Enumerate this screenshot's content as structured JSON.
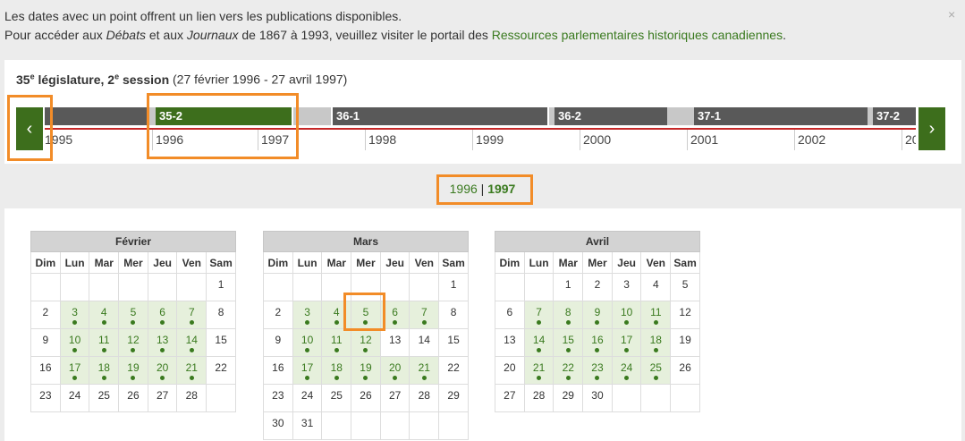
{
  "notice": {
    "line1": "Les dates avec un point offrent un lien vers les publications disponibles.",
    "line2_pre": "Pour accéder aux ",
    "line2_em1": "Débats",
    "line2_mid1": " et aux ",
    "line2_em2": "Journaux",
    "line2_mid2": " de 1867 à 1993, veuillez visiter le portail des ",
    "line2_link": "Ressources parlementaires historiques canadiennes",
    "line2_end": ".",
    "close": "×"
  },
  "session": {
    "num": "35",
    "sup1": "e",
    "legislature": " législature, 2",
    "sup2": "e",
    "session_word": " session",
    "dates": " (27 février 1996 - 27 avril 1997)"
  },
  "nav": {
    "prev": "‹",
    "next": "›"
  },
  "timeline": {
    "segments": [
      {
        "label": "",
        "style": "dark"
      },
      {
        "label": "",
        "style": "light"
      },
      {
        "label": "35-2",
        "style": "active"
      },
      {
        "label": "",
        "style": "light"
      },
      {
        "label": "36-1",
        "style": "dark"
      },
      {
        "label": "",
        "style": "light"
      },
      {
        "label": "36-2",
        "style": "dark"
      },
      {
        "label": "",
        "style": "light"
      },
      {
        "label": "37-1",
        "style": "dark"
      },
      {
        "label": "",
        "style": "light"
      },
      {
        "label": "37-2",
        "style": "dark"
      }
    ],
    "years": [
      "1995",
      "1996",
      "1997",
      "1998",
      "1999",
      "2000",
      "2001",
      "2002",
      "20"
    ]
  },
  "year_selector": {
    "y1": "1996",
    "sep": " | ",
    "y2": "1997"
  },
  "calendars": [
    {
      "month": "Février",
      "days": [
        "Dim",
        "Lun",
        "Mar",
        "Mer",
        "Jeu",
        "Ven",
        "Sam"
      ],
      "weeks": [
        [
          "",
          "",
          "",
          "",
          "",
          "",
          "1"
        ],
        [
          "2",
          "3*",
          "4*",
          "5*",
          "6*",
          "7*",
          "8"
        ],
        [
          "9",
          "10*",
          "11*",
          "12*",
          "13*",
          "14*",
          "15"
        ],
        [
          "16",
          "17*",
          "18*",
          "19*",
          "20*",
          "21*",
          "22"
        ],
        [
          "23",
          "24",
          "25",
          "26",
          "27",
          "28",
          ""
        ]
      ]
    },
    {
      "month": "Mars",
      "days": [
        "Dim",
        "Lun",
        "Mar",
        "Mer",
        "Jeu",
        "Ven",
        "Sam"
      ],
      "weeks": [
        [
          "",
          "",
          "",
          "",
          "",
          "",
          "1"
        ],
        [
          "2",
          "3*",
          "4*",
          "5*",
          "6*",
          "7*",
          "8"
        ],
        [
          "9",
          "10*",
          "11*",
          "12*",
          "13",
          "14",
          "15"
        ],
        [
          "16",
          "17*",
          "18*",
          "19*",
          "20*",
          "21*",
          "22"
        ],
        [
          "23",
          "24",
          "25",
          "26",
          "27",
          "28",
          "29"
        ],
        [
          "30",
          "31",
          "",
          "",
          "",
          "",
          ""
        ]
      ]
    },
    {
      "month": "Avril",
      "days": [
        "Dim",
        "Lun",
        "Mar",
        "Mer",
        "Jeu",
        "Ven",
        "Sam"
      ],
      "weeks": [
        [
          "",
          "",
          "1",
          "2",
          "3",
          "4",
          "5"
        ],
        [
          "6",
          "7*",
          "8*",
          "9*",
          "10*",
          "11*",
          "12"
        ],
        [
          "13",
          "14*",
          "15*",
          "16*",
          "17*",
          "18*",
          "19"
        ],
        [
          "20",
          "21*",
          "22*",
          "23*",
          "24*",
          "25*",
          "26"
        ],
        [
          "27",
          "28",
          "29",
          "30",
          "",
          "",
          ""
        ]
      ]
    }
  ],
  "colors": {
    "accent": "#3d6e1c",
    "link": "#3a7a1f",
    "highlight": "#f28c28",
    "timeline_line": "#c62828",
    "pub_bg": "#e6f0dc"
  }
}
